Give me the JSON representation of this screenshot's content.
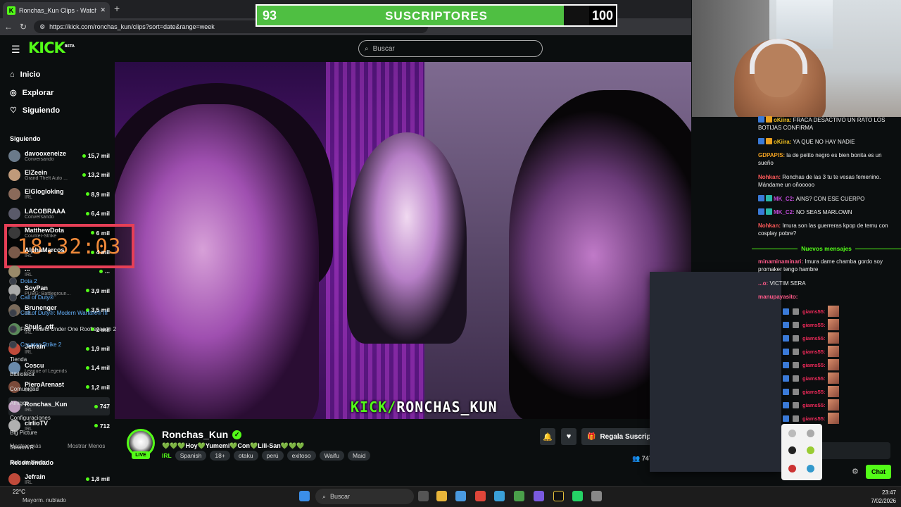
{
  "browser": {
    "tab_title": "Ronchas_Kun Clips - Watch Live o",
    "url": "https://kick.com/ronchas_kun/clips?sort=date&range=week"
  },
  "sub_goal": {
    "current": "93",
    "label": "SUSCRIPTORES",
    "target": "100",
    "progress": 0.93
  },
  "header": {
    "logo": "KICK",
    "logo_sup": "BETA",
    "search_placeholder": "Buscar"
  },
  "sidebar": {
    "nav": [
      {
        "label": "Inicio",
        "icon": "home-icon"
      },
      {
        "label": "Explorar",
        "icon": "compass-icon"
      },
      {
        "label": "Siguiendo",
        "icon": "heart-icon"
      }
    ],
    "following_title": "Siguiendo",
    "channels": [
      {
        "name": "davooxeneize",
        "category": "Conversando",
        "viewers": "15,7 mil"
      },
      {
        "name": "ElZeein",
        "category": "Grand Theft Auto ...",
        "viewers": "13,2 mil"
      },
      {
        "name": "ElGlogloking",
        "category": "IRL",
        "viewers": "8,9 mil"
      },
      {
        "name": "LACOBRAAA",
        "category": "Conversando",
        "viewers": "6,4 mil"
      },
      {
        "name": "MatthewDota",
        "category": "Counter-Strike",
        "viewers": "6 mil"
      },
      {
        "name": "AlphaMarcos",
        "category": "IRL",
        "viewers": "4 mil"
      },
      {
        "name": "...",
        "category": "IRL",
        "viewers": "..."
      },
      {
        "name": "SoyPan",
        "category": "PUBG: Battlegroun...",
        "viewers": "3,9 mil"
      },
      {
        "name": "Brunenger",
        "category": "IRL",
        "viewers": "3,5 mil"
      },
      {
        "name": "Shuls_off",
        "category": "IRL",
        "viewers": "2 mil"
      },
      {
        "name": "Jefrain",
        "category": "IRL",
        "viewers": "1,9 mil"
      },
      {
        "name": "Coscu",
        "category": "League of Legends",
        "viewers": "1,4 mil"
      },
      {
        "name": "PieroArenast",
        "category": "IRL",
        "viewers": "1,2 mil"
      },
      {
        "name": "Ronchas_Kun",
        "category": "IRL",
        "viewers": "747"
      },
      {
        "name": "cirlioTV",
        "category": "IRL",
        "viewers": "712"
      }
    ],
    "show_more": "Mostrar más",
    "show_less": "Mostrar Menos",
    "recommended_title": "Recomendado",
    "recommended": [
      {
        "name": "Jefrain",
        "category": "IRL",
        "viewers": "1,8 mil"
      }
    ]
  },
  "timer": "18:32:03",
  "video_overlay": {
    "prefix": "KICK/",
    "name": "RONCHAS_KUN"
  },
  "stream": {
    "streamer": "Ronchas_Kun",
    "live_badge": "LIVE",
    "title_pre": "💚💚💚Hoy💚Yumemi💚Con💚Lili-San💚💚💚",
    "category": "IRL",
    "tags": [
      "Spanish",
      "18+",
      "otaku",
      "perú",
      "exitoso",
      "Waifu",
      "Maid"
    ],
    "gift_label": "Regala Suscrip",
    "viewers": "747"
  },
  "chat": {
    "messages": [
      {
        "user": "oKiira:",
        "text": " FRACA DESACTIVO UN RATO LOS BOTIJAS CONFIRMA",
        "color": "#f0c020"
      },
      {
        "user": "oKiira:",
        "text": " YA QUE NO HAY NADIE",
        "color": "#f0c020"
      },
      {
        "user": "GDPAPIS:",
        "text": " la de pelito negro es bien bonita es un sueño",
        "color": "#f0a020"
      },
      {
        "user": "Nohkan:",
        "text": " Ronchas de las 3 tu te vesas femenino. Mándame un oñooooo",
        "color": "#ff5a5a"
      },
      {
        "user": "MK_C2:",
        "text": " AINS? CON ESE CUERPO",
        "color": "#c04ad8"
      },
      {
        "user": "MK_C2:",
        "text": " NO SEAS MARLOWN",
        "color": "#c04ad8"
      },
      {
        "user": "Nohkan:",
        "text": " Imura son las guerreras kpop de temu con cosplay pobre?",
        "color": "#ff5a5a"
      }
    ],
    "new_messages": "Nuevos mensajes",
    "after": [
      {
        "user": "minaminaminari:",
        "text": " Imura dame chamba gordo soy promaker tengo hambre",
        "color": "#ff5a8a"
      },
      {
        "user": "...o:",
        "text": " VICTIM SERA",
        "color": "#ff5a8a"
      },
      {
        "user": "manupayasito:",
        "text": "",
        "color": "#ff5a8a"
      }
    ],
    "spam_user": "giams55:",
    "send_label": "Chat"
  },
  "steam_menu": {
    "games": [
      {
        "label": "Dota 2",
        "blue": true
      },
      {
        "label": "Call of Duty®",
        "blue": true
      },
      {
        "label": "Call of Duty®: Modern Warfare® III",
        "blue": true
      },
      {
        "label": "Five Hearts Under One Roof season 2",
        "blue": false
      },
      {
        "label": "Counter-Strike 2",
        "blue": true
      }
    ],
    "items": [
      "Tienda",
      "Biblioteca",
      "Comunidad",
      "Amigos",
      "Configuraciones",
      "Big Picture",
      "SteamVR",
      "Salir de Steam"
    ]
  },
  "taskbar": {
    "temp": "22°C",
    "weather": "Mayorm. nublado",
    "search": "Buscar",
    "time": "23:47",
    "date": "7/02/2026"
  }
}
